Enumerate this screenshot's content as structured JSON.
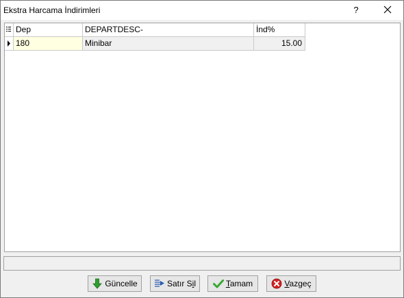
{
  "window": {
    "title": "Ekstra Harcama İndirimleri",
    "help_glyph": "?",
    "close_glyph": "✕"
  },
  "grid": {
    "columns": [
      "Dep",
      "DEPARTDESC-",
      "İnd%"
    ],
    "rows": [
      {
        "dep": "180",
        "desc": "Minibar",
        "pct": "15.00"
      }
    ]
  },
  "buttons": {
    "update": {
      "label": "Güncelle",
      "icon": "down-arrow-icon",
      "color": "#2e9e2e"
    },
    "delete_row": {
      "label_pre": "Satır S",
      "label_u": "i",
      "label_post": "l",
      "icon": "delete-row-icon",
      "color": "#2a5db0"
    },
    "ok": {
      "label_u": "T",
      "label_post": "amam",
      "icon": "checkmark-icon",
      "color": "#3aa832"
    },
    "cancel": {
      "label_u": "V",
      "label_post": "azgeç",
      "icon": "cancel-x-icon",
      "color": "#d22323"
    }
  }
}
